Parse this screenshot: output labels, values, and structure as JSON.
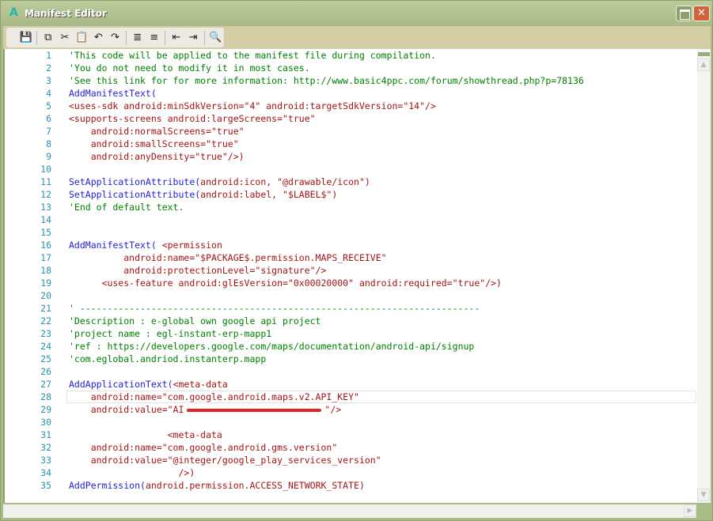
{
  "window": {
    "title": "Manifest Editor",
    "app_icon": "A",
    "close": "✕"
  },
  "toolbar": [
    {
      "name": "save-icon",
      "glyph": "💾"
    },
    {
      "name": "copy-icon",
      "glyph": "⧉"
    },
    {
      "name": "cut-icon",
      "glyph": "✂"
    },
    {
      "name": "paste-icon",
      "glyph": "📋"
    },
    {
      "name": "undo-icon",
      "glyph": "↶"
    },
    {
      "name": "redo-icon",
      "glyph": "↷"
    },
    {
      "name": "comment-icon",
      "glyph": "≣"
    },
    {
      "name": "uncomment-icon",
      "glyph": "≡"
    },
    {
      "name": "outdent-icon",
      "glyph": "⇤"
    },
    {
      "name": "indent-icon",
      "glyph": "⇥"
    },
    {
      "name": "search-icon",
      "glyph": "🔍"
    }
  ],
  "current_line": 28,
  "lines": [
    [
      [
        "c",
        "'This code will be applied to the manifest file during compilation."
      ]
    ],
    [
      [
        "c",
        "'You do not need to modify it in most cases."
      ]
    ],
    [
      [
        "c",
        "'See this link for for more information: http://www.basic4ppc.com/forum/showthread.php?p=78136"
      ]
    ],
    [
      [
        "k",
        "AddManifestText("
      ]
    ],
    [
      [
        "s",
        "<uses-sdk android:minSdkVersion=\"4\" android:targetSdkVersion=\"14\"/>"
      ]
    ],
    [
      [
        "s",
        "<supports-screens android:largeScreens=\"true\""
      ]
    ],
    [
      [
        "s",
        "    android:normalScreens=\"true\""
      ]
    ],
    [
      [
        "s",
        "    android:smallScreens=\"true\""
      ]
    ],
    [
      [
        "s",
        "    android:anyDensity=\"true\"/>)"
      ]
    ],
    [],
    [
      [
        "k",
        "SetApplicationAttribute("
      ],
      [
        "s",
        "android:icon, \"@drawable/icon\")"
      ]
    ],
    [
      [
        "k",
        "SetApplicationAttribute("
      ],
      [
        "s",
        "android:label, \"$LABEL$\")"
      ]
    ],
    [
      [
        "c",
        "'End of default text."
      ]
    ],
    [],
    [],
    [
      [
        "k",
        "AddManifestText( "
      ],
      [
        "s",
        "<permission"
      ]
    ],
    [
      [
        "s",
        "          android:name=\"$PACKAGE$.permission.MAPS_RECEIVE\""
      ]
    ],
    [
      [
        "s",
        "          android:protectionLevel=\"signature\"/>"
      ]
    ],
    [
      [
        "s",
        "      <uses-feature android:glEsVersion=\"0x00020000\" android:required=\"true\"/>)"
      ]
    ],
    [],
    [
      [
        "c",
        "' -------------------------------------------------------------------------"
      ]
    ],
    [
      [
        "c",
        "'Description : e-global own google api project"
      ]
    ],
    [
      [
        "c",
        "'project name : egl-instant-erp-mapp1"
      ]
    ],
    [
      [
        "c",
        "'ref : https://developers.google.com/maps/documentation/android-api/signup"
      ]
    ],
    [
      [
        "c",
        "'com.eglobal.andriod.instanterp.mapp"
      ]
    ],
    [],
    [
      [
        "k",
        "AddApplicationText("
      ],
      [
        "s",
        "<meta-data"
      ]
    ],
    [
      [
        "s",
        "    android:name=\"com.google.android.maps.v2.API_KEY\""
      ]
    ],
    [
      [
        "s",
        "    android:value=\"AI"
      ],
      [
        "r",
        ""
      ],
      [
        "s",
        "\"/>"
      ]
    ],
    [],
    [
      [
        "s",
        "                  <meta-data"
      ]
    ],
    [
      [
        "s",
        "    android:name=\"com.google.android.gms.version\""
      ]
    ],
    [
      [
        "s",
        "    android:value=\"@integer/google_play_services_version\""
      ]
    ],
    [
      [
        "s",
        "                    />)"
      ]
    ],
    [
      [
        "k",
        "AddPermission("
      ],
      [
        "s",
        "android.permission.ACCESS_NETWORK_STATE)"
      ]
    ]
  ]
}
